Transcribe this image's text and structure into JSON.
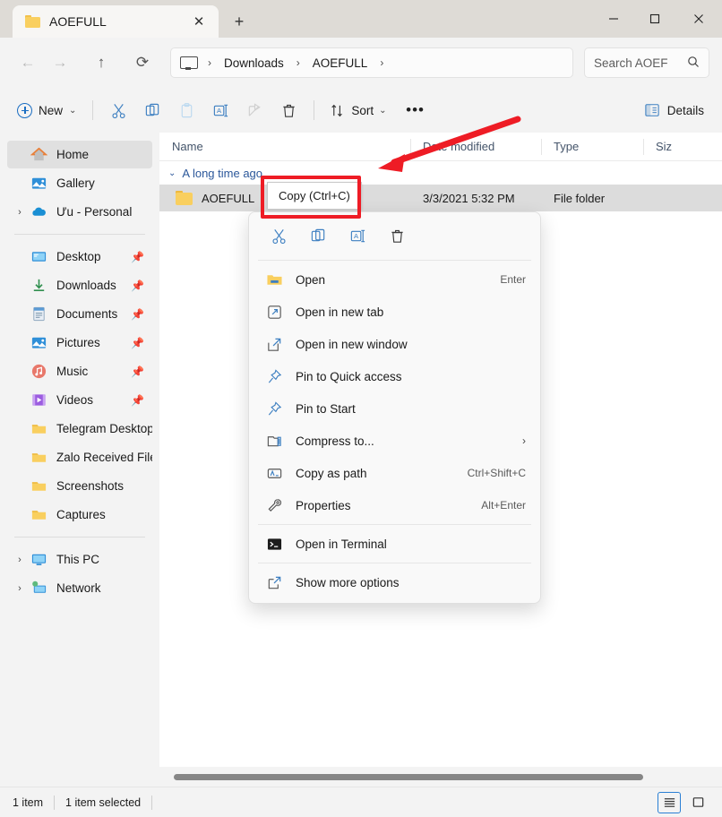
{
  "window": {
    "tab_title": "AOEFULL",
    "tab_close_glyph": "✕",
    "new_tab_glyph": "+",
    "minimize_glyph": "–",
    "maximize_glyph": "❐",
    "close_glyph": "✕"
  },
  "nav": {
    "back_glyph": "←",
    "forward_glyph": "→",
    "up_glyph": "↑",
    "refresh_glyph": "⟳",
    "breadcrumb": [
      {
        "label": "Downloads"
      },
      {
        "label": "AOEFULL"
      }
    ],
    "chevron": "›",
    "search_placeholder": "Search AOEF",
    "search_icon_glyph": "⌕"
  },
  "toolbar": {
    "new_label": "New",
    "caret_glyph": "⌄",
    "cut_label": "Cut",
    "copy_label": "Copy",
    "paste_label": "Paste",
    "rename_label": "Rename",
    "share_label": "Share",
    "delete_label": "Delete",
    "sort_label": "Sort",
    "more_glyph": "•••",
    "details_label": "Details"
  },
  "sidebar": {
    "items": [
      {
        "label": "Home",
        "icon": "home-icon",
        "selected": true,
        "expandable": false,
        "pinned": false
      },
      {
        "label": "Gallery",
        "icon": "gallery-icon",
        "selected": false,
        "expandable": false,
        "pinned": false
      },
      {
        "label": "Ưu - Personal",
        "icon": "onedrive-icon",
        "selected": false,
        "expandable": true,
        "pinned": false
      }
    ],
    "pinned_items": [
      {
        "label": "Desktop",
        "icon": "desktop-icon",
        "pinned": true
      },
      {
        "label": "Downloads",
        "icon": "downloads-icon",
        "pinned": true
      },
      {
        "label": "Documents",
        "icon": "documents-icon",
        "pinned": true
      },
      {
        "label": "Pictures",
        "icon": "pictures-icon",
        "pinned": true
      },
      {
        "label": "Music",
        "icon": "music-icon",
        "pinned": true
      },
      {
        "label": "Videos",
        "icon": "videos-icon",
        "pinned": true
      },
      {
        "label": "Telegram Desktop",
        "icon": "folder-icon",
        "pinned": false
      },
      {
        "label": "Zalo Received Files",
        "icon": "folder-icon",
        "pinned": false
      },
      {
        "label": "Screenshots",
        "icon": "folder-icon",
        "pinned": false
      },
      {
        "label": "Captures",
        "icon": "folder-icon",
        "pinned": false
      }
    ],
    "bottom_items": [
      {
        "label": "This PC",
        "icon": "thispc-icon",
        "expandable": true
      },
      {
        "label": "Network",
        "icon": "network-icon",
        "expandable": true
      }
    ],
    "chevron_glyph": "›"
  },
  "filelist": {
    "columns": [
      {
        "label": "Name"
      },
      {
        "label": "Date modified",
        "sorted": true
      },
      {
        "label": "Type"
      },
      {
        "label": "Siz"
      }
    ],
    "sort_chevron": "⌄",
    "group_chevron": "⌄",
    "group_label": "A long time ago",
    "rows": [
      {
        "name": "AOEFULL",
        "date_modified": "3/3/2021 5:32 PM",
        "type": "File folder",
        "size": "",
        "selected": true
      }
    ]
  },
  "contextmenu": {
    "icon_buttons": [
      {
        "name": "cut",
        "label": "Cut"
      },
      {
        "name": "copy",
        "label": "Copy"
      },
      {
        "name": "rename",
        "label": "Rename"
      },
      {
        "name": "delete",
        "label": "Delete"
      }
    ],
    "items": [
      {
        "label": "Open",
        "accel": "Enter",
        "icon": "folder-icon",
        "submenu": false
      },
      {
        "label": "Open in new tab",
        "accel": "",
        "icon": "open-new-tab-icon",
        "submenu": false
      },
      {
        "label": "Open in new window",
        "accel": "",
        "icon": "open-new-window-icon",
        "submenu": false
      },
      {
        "label": "Pin to Quick access",
        "accel": "",
        "icon": "pin-icon",
        "submenu": false
      },
      {
        "label": "Pin to Start",
        "accel": "",
        "icon": "pin-icon",
        "submenu": false
      },
      {
        "label": "Compress to...",
        "accel": "",
        "icon": "compress-icon",
        "submenu": true
      },
      {
        "label": "Copy as path",
        "accel": "Ctrl+Shift+C",
        "icon": "copy-as-path-icon",
        "submenu": false
      },
      {
        "label": "Properties",
        "accel": "Alt+Enter",
        "icon": "properties-icon",
        "submenu": false
      }
    ],
    "terminal_item": {
      "label": "Open in Terminal",
      "accel": "",
      "icon": "terminal-icon"
    },
    "more_item": {
      "label": "Show more options",
      "accel": "",
      "icon": "show-more-options-icon"
    },
    "submenu_glyph": "›"
  },
  "tooltip": {
    "text": "Copy (Ctrl+C)"
  },
  "annotation": {
    "highlight_color": "#ee1c25",
    "arrow_color": "#ee1c25"
  },
  "statusbar": {
    "item_count": "1 item",
    "selection": "1 item selected"
  }
}
